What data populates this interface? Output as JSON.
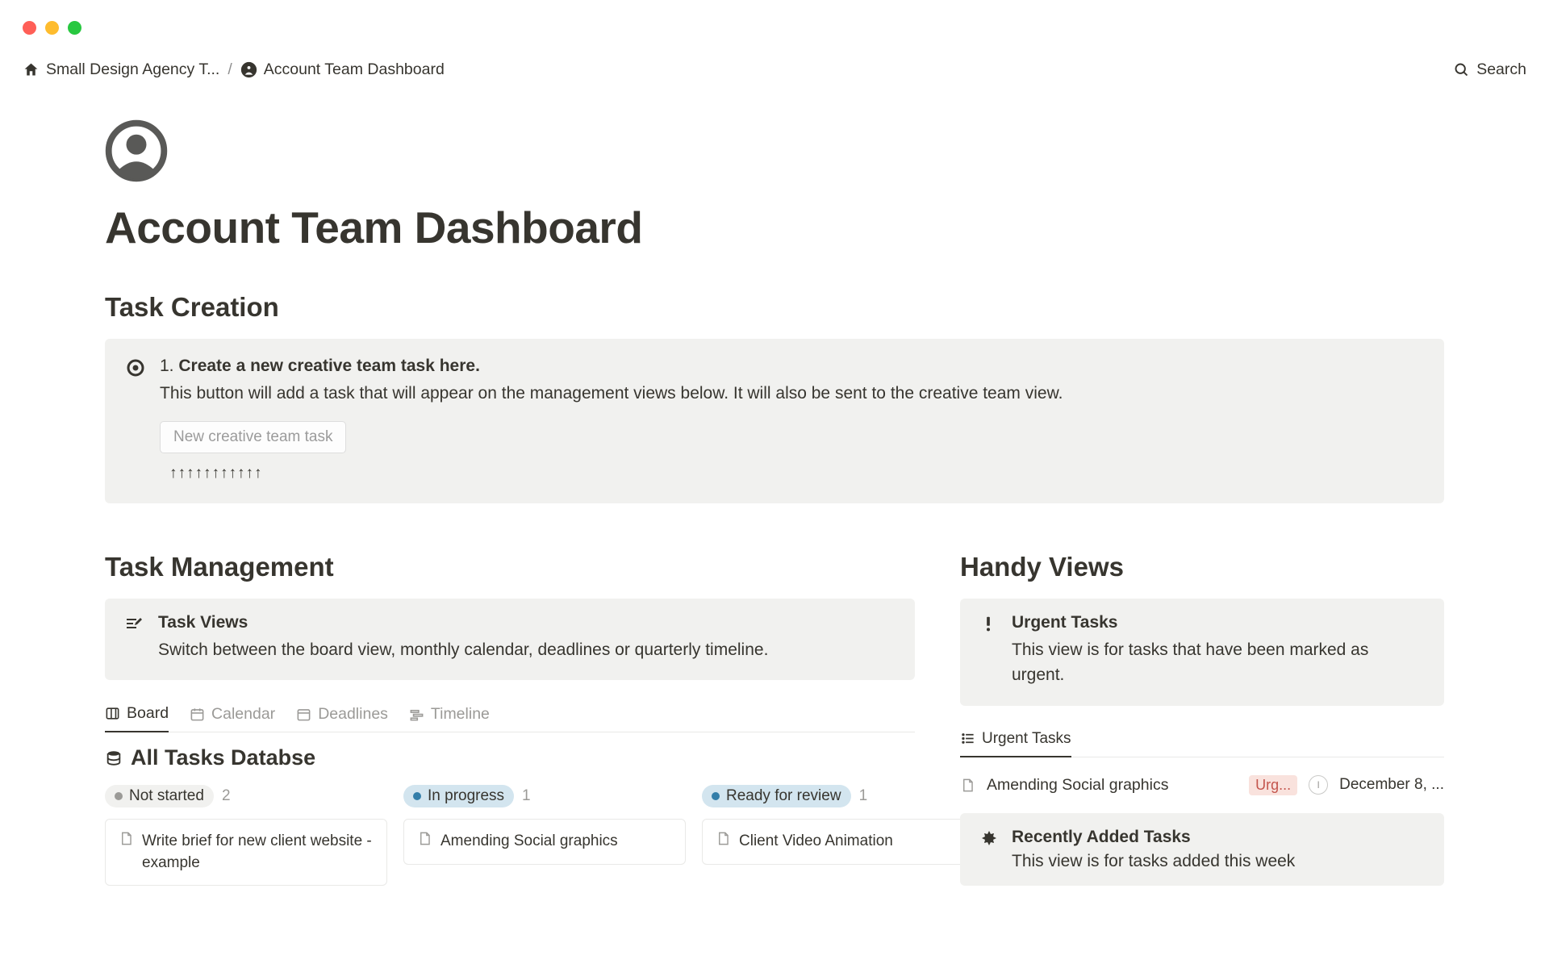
{
  "breadcrumb": {
    "item1": "Small Design Agency T...",
    "item2": "Account Team Dashboard"
  },
  "search_label": "Search",
  "page_title": "Account Team Dashboard",
  "task_creation": {
    "heading": "Task Creation",
    "prefix": "1. ",
    "title": "Create a new creative team task here.",
    "desc": "This button will add a task that will appear on the management views below. It will also be sent to the creative team view.",
    "button_label": "New creative team task",
    "arrows": "↑↑↑↑↑↑↑↑↑↑↑"
  },
  "task_management": {
    "heading": "Task Management",
    "callout_title": "Task Views",
    "callout_desc": "Switch between the board view, monthly calendar, deadlines or quarterly timeline.",
    "tabs": {
      "board": "Board",
      "calendar": "Calendar",
      "deadlines": "Deadlines",
      "timeline": "Timeline"
    },
    "db_title": "All Tasks Databse",
    "board_columns": [
      {
        "status": "Not started",
        "count": "2",
        "card": "Write brief for new client website - example"
      },
      {
        "status": "In progress",
        "count": "1",
        "card": "Amending Social graphics"
      },
      {
        "status": "Ready for review",
        "count": "1",
        "card": "Client Video Animation"
      }
    ]
  },
  "handy_views": {
    "heading": "Handy Views",
    "urgent_title": "Urgent Tasks",
    "urgent_desc": "This view is for tasks that have been marked as urgent.",
    "list_tab": "Urgent Tasks",
    "row": {
      "title": "Amending Social graphics",
      "badge": "Urg...",
      "avatar": "I",
      "date": "December 8, ..."
    },
    "recent_title": "Recently Added Tasks",
    "recent_desc": "This view is for tasks added this week"
  }
}
